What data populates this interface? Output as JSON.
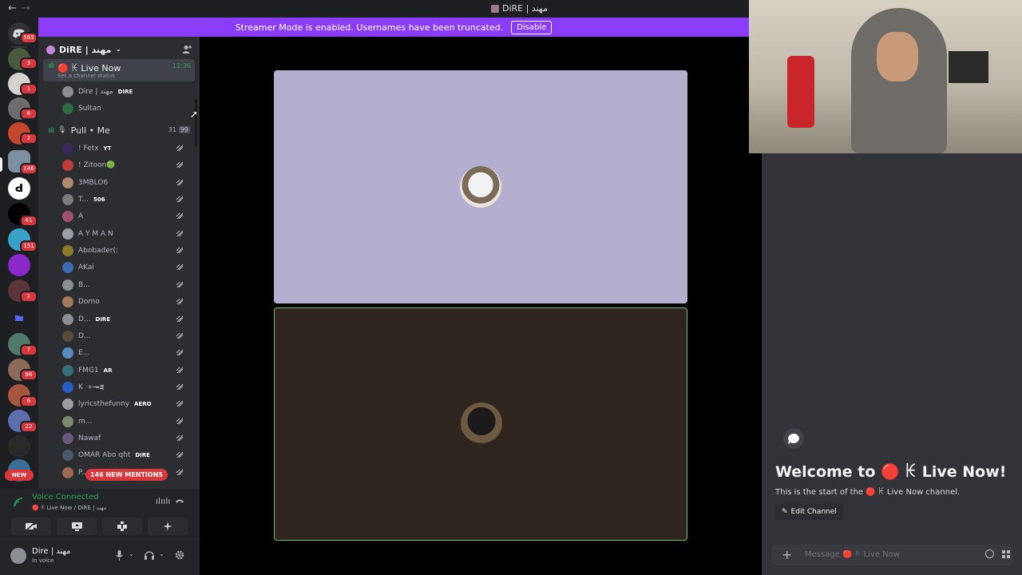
{
  "window": {
    "title": "DiRE | مهند",
    "back_icon": "←",
    "forward_icon": "→"
  },
  "banner": {
    "text": "Streamer Mode is enabled. Usernames have been truncated.",
    "button": "Disable",
    "color": "#8b3cf6"
  },
  "guilds": {
    "badges": [
      "585",
      "3",
      "1",
      "6",
      "2",
      "146",
      "41",
      "151",
      "1",
      "7",
      "86",
      "6",
      "22"
    ],
    "new_label": "NEW"
  },
  "server": {
    "name": "DiRE | مهند"
  },
  "channels": {
    "live": {
      "name": "🔴 ꀘ Live Now",
      "time": "11:36",
      "status_placeholder": "Set a channel status"
    },
    "live_users": [
      {
        "name": "Dire | مهند",
        "tag": "DIRE"
      },
      {
        "name": "Sultan",
        "tag": ""
      }
    ],
    "pull": {
      "name": "Pull • Me",
      "count": "31",
      "limit": "99"
    },
    "pull_users": [
      {
        "name": "! Fetx",
        "tag": "YT"
      },
      {
        "name": "! Zitoon🟢",
        "tag": ""
      },
      {
        "name": "3MBLO6",
        "tag": ""
      },
      {
        "name": "T...",
        "tag": "506"
      },
      {
        "name": "A",
        "tag": ""
      },
      {
        "name": "A Y M A N",
        "tag": ""
      },
      {
        "name": "Abobader(:",
        "tag": ""
      },
      {
        "name": "AKai",
        "tag": ""
      },
      {
        "name": "B...",
        "tag": ""
      },
      {
        "name": "Domo",
        "tag": ""
      },
      {
        "name": "D...",
        "tag": "DIRE"
      },
      {
        "name": "D...",
        "tag": ""
      },
      {
        "name": "E...",
        "tag": ""
      },
      {
        "name": "FMG1",
        "tag": "AR"
      },
      {
        "name": "K",
        "tag": "✧─═ミ"
      },
      {
        "name": "lyricsthefunny",
        "tag": "AERO"
      },
      {
        "name": "m...",
        "tag": ""
      },
      {
        "name": "Nawaf",
        "tag": ""
      },
      {
        "name": "OMAR Abo qht",
        "tag": "DIRE"
      },
      {
        "name": "P...",
        "tag": ""
      }
    ],
    "new_mentions": "146 NEW MENTIONS"
  },
  "voice": {
    "title": "Voice Connected",
    "sub": "🔴 ꀘ Live Now / DiRE | مهند"
  },
  "user_panel": {
    "name": "Dire | مهند",
    "status": "In voice"
  },
  "chat": {
    "welcome_title": "Welcome to 🔴 ꀘ Live Now!",
    "welcome_sub": "This is the start of the 🔴 ꀘ Live Now channel.",
    "edit_button": "Edit Channel",
    "placeholder": "Message 🔴 ꀘ Live Now"
  },
  "colors": {
    "accent_green": "#23a55a",
    "tile1": "#b4afcf",
    "tile2": "#2e261e",
    "red": "#da373c"
  }
}
